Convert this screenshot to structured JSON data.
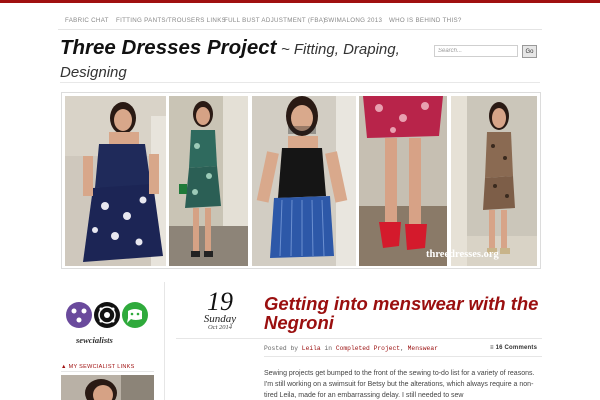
{
  "nav": {
    "items": [
      {
        "label": "Fabric Chat"
      },
      {
        "label": "Fitting Pants/Trousers Links"
      },
      {
        "label": "Full Bust Adjustment (FBA)"
      },
      {
        "label": "Swimalong 2013"
      },
      {
        "label": "Who is behind this?"
      }
    ]
  },
  "site": {
    "title": "Three Dresses Project",
    "tagline": "~ Fitting, Draping, Designing"
  },
  "search": {
    "placeholder": "Search...",
    "button_label": "Go"
  },
  "banner": {
    "caption": "threedresses.org"
  },
  "sidebar": {
    "badge_label": "sewcialists",
    "links_heading": "▲ My Sewcialist Links"
  },
  "post": {
    "day": "19",
    "weekday": "Sunday",
    "month_year": "Oct 2014",
    "title": "Getting into menswear with the Negroni",
    "meta_prefix": "Posted by",
    "author": "Leila",
    "meta_in": "in",
    "category1": "Completed Project",
    "category2": "Menswear",
    "comments": "≡ 16 Comments",
    "body": "Sewing projects get bumped to the front of the sewing to-do list for a variety of reasons. I'm still working on a swimsuit for Betsy but the alterations, which always require a non-tired Leila, made for an embarrassing delay. I still needed to sew"
  },
  "colors": {
    "accent": "#9a0f0f",
    "top_rule": "#a01010"
  }
}
